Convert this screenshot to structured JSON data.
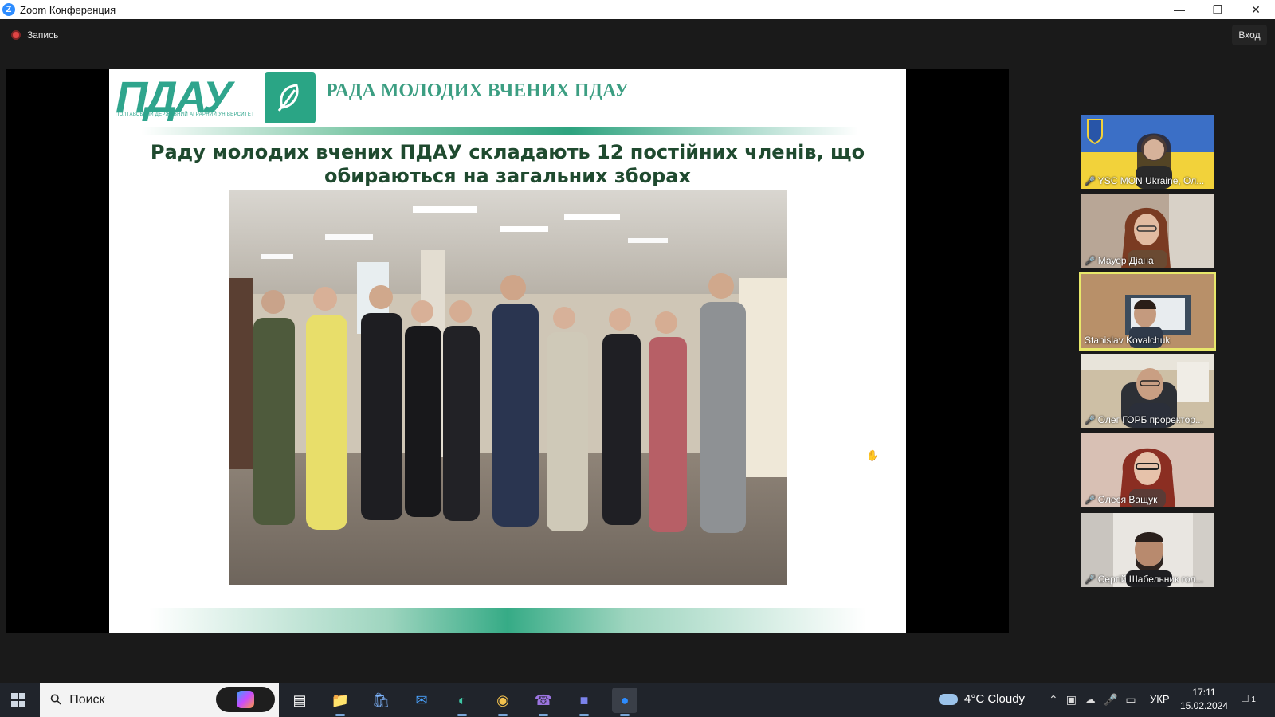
{
  "window": {
    "title": "Zoom Конференция",
    "app_icon": "Z"
  },
  "zoom_bar": {
    "recording_label": "Запись",
    "signin_label": "Вход"
  },
  "slide": {
    "logo_text": "ПДАУ",
    "logo_subtitle": "ПОЛТАВСЬКИЙ ДЕРЖАВНИЙ АГРАРНИЙ УНІВЕРСИТЕТ",
    "heading": "РАДА МОЛОДИХ ВЧЕНИХ ПДАУ",
    "title": "Раду молодих вчених ПДАУ складають 12 постійних членів, що обираються на загальних зборах"
  },
  "participants": [
    {
      "name": "YSC MON Ukraine, Ол...",
      "muted": true,
      "active": false
    },
    {
      "name": "Мауер Діана",
      "muted": true,
      "active": false
    },
    {
      "name": "Stanislav Kovalchuk",
      "muted": false,
      "active": true
    },
    {
      "name": "Олег ГОРБ проректор...",
      "muted": true,
      "active": false
    },
    {
      "name": "Олеся Ващук",
      "muted": true,
      "active": false
    },
    {
      "name": "Сергій Шабельник гол...",
      "muted": true,
      "active": false
    }
  ],
  "taskbar": {
    "search_placeholder": "Поиск",
    "weather": "4°C  Cloudy",
    "language": "УКР",
    "time": "17:11",
    "date": "15.02.2024",
    "notification_count": "1"
  },
  "colors": {
    "brand_green": "#2fa58d",
    "title_green": "#1f4a2f",
    "active_speaker": "#e8e86a",
    "muted_red": "#e23a3a"
  }
}
